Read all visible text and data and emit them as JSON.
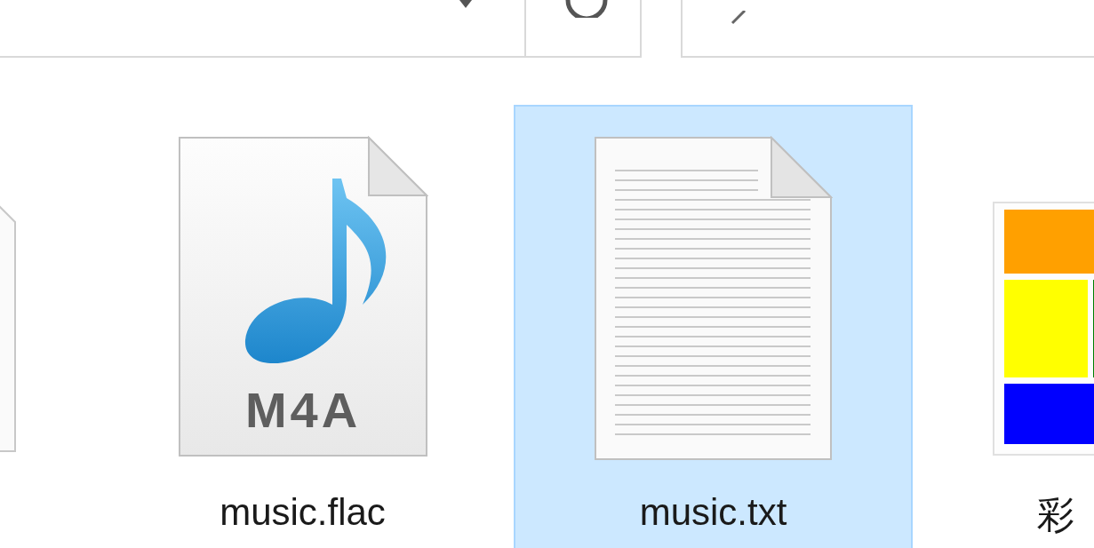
{
  "files": [
    {
      "kind": "document",
      "selected": false
    },
    {
      "name": "music.flac",
      "kind": "audio",
      "badge": "M4A",
      "selected": false
    },
    {
      "name": "music.txt",
      "kind": "text",
      "selected": true
    },
    {
      "name": "彩",
      "kind": "image",
      "selected": false
    }
  ]
}
